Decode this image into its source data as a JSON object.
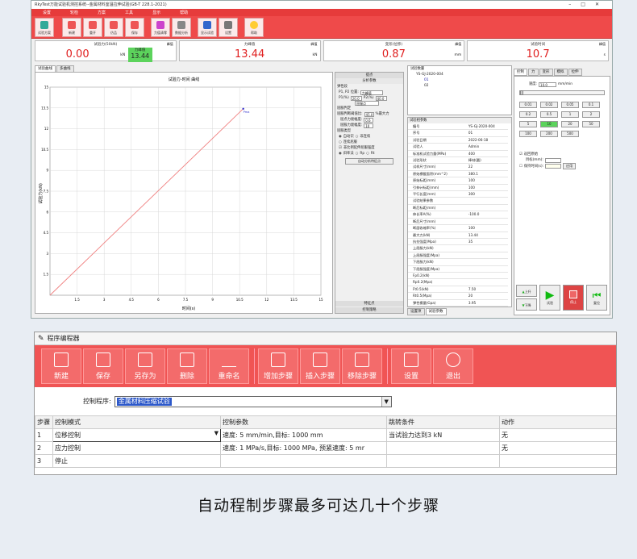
{
  "app1": {
    "title": "RkyTest万能试验机测控系统--金属材料室温拉伸试验(GB-T 228.1-2021)",
    "menu": [
      "设置",
      "轮检",
      "方案",
      "工具",
      "显示",
      "帮助"
    ],
    "toolbar": [
      "试验方案",
      "新建",
      "重开",
      "仿品",
      "保存",
      "力值清零",
      "数据分析",
      "显示试验",
      "设置",
      "帮助"
    ],
    "meters": [
      {
        "caption": "试验力(50kN)",
        "value": "0.00",
        "unit": "kN",
        "sel": "峰值",
        "peak_label": "力峰值",
        "peak_value": "13.44"
      },
      {
        "caption": "力峰值",
        "value": "13.44",
        "unit": "kN",
        "sel": "峰值"
      },
      {
        "caption": "变形(位移)",
        "value": "0.87",
        "unit": "mm",
        "sel": "峰值"
      },
      {
        "caption": "试验时间",
        "value": "10.7",
        "unit": "s",
        "sel": "峰值"
      }
    ],
    "chart_tabs": [
      "试验曲线",
      "多曲线"
    ],
    "chart_title": "试验力-时间 曲线",
    "side_header": "提点",
    "side_tab": "分析参数",
    "point_label": "Pma",
    "params": {
      "grp1": "弹性段",
      "p12_label": "P1, P2 位置:",
      "p12_select": "力峰值",
      "p1_label": "P1(%)",
      "p1_val": "20.0",
      "p2_label": "P2(%)",
      "p2_val": "40.0",
      "p_select": "屈服点",
      "grp2": "屈服判定",
      "r1_label": "屈服判断阈值比:",
      "r1_val": "45.0",
      "r1_unit": "%最大力",
      "r2_label": "屈点力衰幅度:",
      "r2_val": "0.6",
      "r3_label": "屈服力衰幅度:",
      "r3_val": "10",
      "grp3": "屈服类型",
      "t1": "自动识",
      "t2": "非连续",
      "t3": "连续屈服",
      "cb_label": "非比例延伸屈服强度",
      "rb1": "斜率法",
      "rb2": "Rp",
      "rb3": "Rt",
      "auto_btn": "自动分析特征点"
    },
    "side_footer": [
      "特征点",
      "控制策略"
    ],
    "tree_header": "试验数量",
    "tree": [
      "YS-GJ-2020-004",
      "01",
      "02"
    ],
    "grid_header": "试验相参数",
    "grid_rows": [
      [
        "编号",
        "YS-GJ-2020-004"
      ],
      [
        "序号",
        "01"
      ],
      [
        "试验日期",
        "2022-06-18"
      ],
      [
        "试验人",
        "Admin"
      ],
      [
        "标准机试验力量(MPa)",
        "400"
      ],
      [
        "试验形状",
        "棒材(圆)"
      ],
      [
        "试样尺寸(mm)",
        "22"
      ],
      [
        "原始横截面积(mm^2)",
        "380.1"
      ],
      [
        "原始标距(mm)",
        "100"
      ],
      [
        "引伸计标距(mm)",
        "100"
      ],
      [
        "平行长度(mm)",
        "300"
      ],
      [
        "试验结果参数",
        ""
      ],
      [
        "断后标距(mm)",
        ""
      ],
      [
        "伸长率A(%)",
        "-100.0"
      ],
      [
        "断后尺寸(mm)",
        ""
      ],
      [
        "断面收缩率(%)",
        "100"
      ],
      [
        "最大力(kN)",
        "13.44"
      ],
      [
        "抗拉强度(Mpa)",
        "35"
      ],
      [
        "上屈服力(kN)",
        ""
      ],
      [
        "上屈服强度(Mpa)",
        ""
      ],
      [
        "下屈服力(kN)",
        ""
      ],
      [
        "下屈服强度(Mpa)",
        ""
      ],
      [
        "Fp0.2(kN)",
        ""
      ],
      [
        "Rp0.2(Mpa)",
        ""
      ],
      [
        "Ft0.5(kN)",
        "7.50"
      ],
      [
        "Rt0.5(Mpa)",
        "20"
      ],
      [
        "弹性模量(Gpa)",
        "3.95"
      ],
      [
        "屈服点延伸率(%)",
        ""
      ],
      [
        "最大力总延伸率Agt(%)",
        "0.63"
      ]
    ],
    "grid_tabs": [
      "设置项",
      "试验参数"
    ],
    "right_tabs": [
      "控制",
      "力",
      "变形",
      "模拟",
      "拉伸"
    ],
    "speed_label": "速度:",
    "speed_val": "10.0",
    "speed_unit": "mm/min",
    "speed_btns": [
      "0.01",
      "0.02",
      "0.05",
      "0.1",
      "0.2",
      "0.5",
      "1",
      "2",
      "5",
      "10",
      "20",
      "50",
      "100",
      "200",
      "500"
    ],
    "chk1": "返回原始",
    "target_label": "目标(mm):",
    "chk2": "保持时间(s):",
    "apply": "应用",
    "ctrl_btns": [
      "上升",
      "试验",
      "停止",
      "下降",
      "复位"
    ]
  },
  "app2": {
    "title": "程序编程器",
    "toolbar": [
      "新建",
      "保存",
      "另存为",
      "删除",
      "重命名",
      "增加步骤",
      "插入步骤",
      "移除步骤",
      "设置",
      "退出"
    ],
    "ctrl_label": "控制程序:",
    "ctrl_value": "金属材料压缩试验",
    "headers": [
      "步骤",
      "控制模式",
      "控制参数",
      "跳转条件",
      "动作"
    ],
    "rows": [
      [
        "1",
        "位移控制",
        "速度: 5 mm/min,目标: 1000 mm",
        "当试验力达到3 kN",
        "无"
      ],
      [
        "2",
        "应力控制",
        "速度: 1 MPa/s,目标: 1000 MPa, 预紧速度: 5 mr",
        "",
        "无"
      ],
      [
        "3",
        "停止",
        "",
        "",
        ""
      ]
    ]
  },
  "caption": "自动程制步骤最多可达几十个步骤",
  "chart_data": {
    "type": "line",
    "title": "试验力-时间 曲线",
    "xlabel": "时间(s)",
    "ylabel": "试验力(kN)",
    "xlim": [
      0,
      15
    ],
    "ylim": [
      0,
      15
    ],
    "xticks": [
      "1.5",
      "3",
      "4.5",
      "6",
      "7.5",
      "9",
      "10.5",
      "12",
      "13.5",
      "15"
    ],
    "yticks": [
      "1.5",
      "3",
      "4.5",
      "6",
      "7.5",
      "9",
      "10.5",
      "12",
      "13.5",
      "15"
    ],
    "series": [
      {
        "x": [
          0,
          10.7
        ],
        "y": [
          0,
          13.44
        ]
      }
    ],
    "color": "#f08080"
  }
}
